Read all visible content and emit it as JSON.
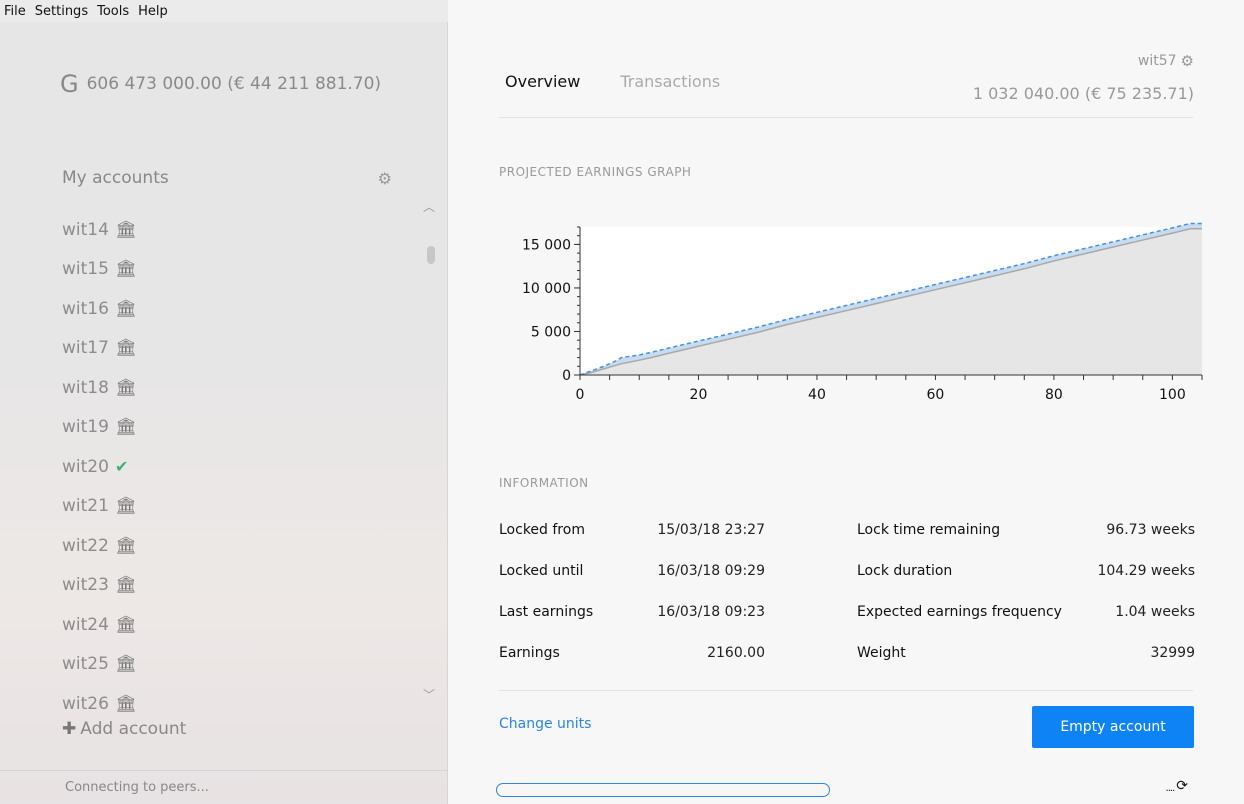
{
  "menu": [
    "File",
    "Settings",
    "Tools",
    "Help"
  ],
  "sidebar": {
    "logo_glyph": "G",
    "total_balance": "606 473 000.00 (€ 44 211 881.70)",
    "accounts_header": "My accounts",
    "accounts": [
      {
        "name": "wit14",
        "icon": "bank-icon"
      },
      {
        "name": "wit15",
        "icon": "bank-icon"
      },
      {
        "name": "wit16",
        "icon": "bank-icon"
      },
      {
        "name": "wit17",
        "icon": "bank-icon"
      },
      {
        "name": "wit18",
        "icon": "bank-icon"
      },
      {
        "name": "wit19",
        "icon": "bank-icon"
      },
      {
        "name": "wit20",
        "icon": "check-icon"
      },
      {
        "name": "wit21",
        "icon": "bank-icon"
      },
      {
        "name": "wit22",
        "icon": "bank-icon"
      },
      {
        "name": "wit23",
        "icon": "bank-icon"
      },
      {
        "name": "wit24",
        "icon": "bank-icon"
      },
      {
        "name": "wit25",
        "icon": "bank-icon"
      },
      {
        "name": "wit26",
        "icon": "bank-icon"
      }
    ],
    "add_account": "Add account",
    "status": "Connecting to peers..."
  },
  "main": {
    "tabs": [
      {
        "label": "Overview",
        "active": true
      },
      {
        "label": "Transactions",
        "active": false
      }
    ],
    "account_name": "wit57",
    "account_balance": "1 032 040.00 (€ 75 235.71)",
    "graph_title": "PROJECTED EARNINGS GRAPH",
    "info_title": "INFORMATION",
    "info_rows": [
      {
        "l1": "Locked from",
        "v1": "15/03/18 23:27",
        "l2": "Lock time remaining",
        "v2": "96.73 weeks"
      },
      {
        "l1": "Locked until",
        "v1": "16/03/18 09:29",
        "l2": "Lock duration",
        "v2": "104.29 weeks"
      },
      {
        "l1": "Last earnings",
        "v1": "16/03/18 09:23",
        "l2": "Expected earnings frequency",
        "v2": "1.04 weeks"
      },
      {
        "l1": "Earnings",
        "v1": "2160.00",
        "l2": "Weight",
        "v2": "32999"
      }
    ],
    "change_units": "Change units",
    "empty_button": "Empty account",
    "sync_dots": "....",
    "progress": 0.0
  },
  "colors": {
    "accent": "#0e83f5",
    "link": "#2a86e0",
    "projection_line": "#4a90d9",
    "projection_fill": "#c7dcef",
    "actual_fill": "#e6e6e6",
    "actual_line": "#a9a9a9",
    "check": "#3cb371"
  },
  "chart_data": {
    "type": "area",
    "x_ticks": [
      0,
      20,
      40,
      60,
      80,
      100
    ],
    "y_ticks": [
      0,
      5000,
      10000,
      15000
    ],
    "y_tick_labels": [
      "0",
      "5 000",
      "10 000",
      "15 000"
    ],
    "xlim": [
      0,
      105
    ],
    "ylim": [
      0,
      17000
    ],
    "series": [
      {
        "style": "projection",
        "x": [
          0,
          2,
          4,
          6,
          7,
          10,
          12,
          15,
          20,
          25,
          30,
          35,
          40,
          45,
          50,
          55,
          60,
          65,
          70,
          75,
          80,
          85,
          90,
          95,
          100,
          103,
          105
        ],
        "y": [
          0,
          500,
          1000,
          1600,
          2000,
          2300,
          2600,
          3100,
          3900,
          4700,
          5500,
          6400,
          7200,
          8000,
          8800,
          9600,
          10400,
          11200,
          12000,
          12800,
          13700,
          14500,
          15300,
          16100,
          16900,
          17400,
          17400
        ]
      },
      {
        "style": "actual",
        "x": [
          0,
          2,
          4,
          6,
          7,
          10,
          12,
          15,
          20,
          25,
          30,
          35,
          40,
          45,
          50,
          55,
          60,
          65,
          70,
          75,
          80,
          85,
          90,
          95,
          100,
          103,
          105
        ],
        "y": [
          0,
          300,
          700,
          1100,
          1300,
          1700,
          2000,
          2500,
          3300,
          4100,
          4900,
          5800,
          6600,
          7400,
          8200,
          9000,
          9800,
          10600,
          11400,
          12200,
          13100,
          13900,
          14700,
          15500,
          16300,
          16800,
          16800
        ]
      }
    ]
  }
}
